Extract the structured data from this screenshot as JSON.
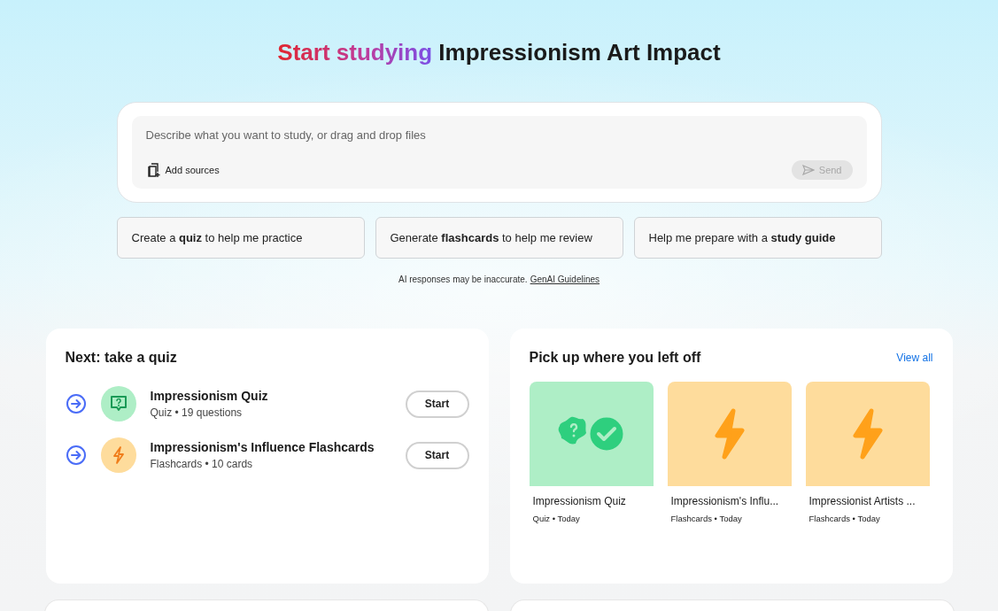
{
  "heading": {
    "highlight": "Start studying",
    "subject": "Impressionism Art Impact"
  },
  "prompt": {
    "placeholder": "Describe what you want to study, or drag and drop files",
    "add_sources": "Add sources",
    "send": {
      "label": "Send",
      "disabled": true
    }
  },
  "suggestions": [
    "Create a **quiz** to help me practice",
    "Generate **flashcards** to help me review",
    "Help me prepare with a **study guide**"
  ],
  "disclaimer": {
    "text": "AI responses may be inaccurate.",
    "link": "GenAI Guidelines"
  },
  "next": {
    "title": "Next: take a quiz",
    "items": [
      {
        "kind": "quiz",
        "title": "Impressionism Quiz",
        "meta": "Quiz • 19 questions",
        "action": "Start"
      },
      {
        "kind": "flashcards",
        "title": "Impressionism's Influence Flashcards",
        "meta": "Flashcards • 10 cards",
        "action": "Start"
      }
    ]
  },
  "recent": {
    "title": "Pick up where you left off",
    "link": "View all",
    "items": [
      {
        "kind": "quiz",
        "title": "Impressionism Quiz",
        "meta": "Quiz • Today"
      },
      {
        "kind": "flashcards",
        "title": "Impressionism's Influ...",
        "meta": "Flashcards • Today"
      },
      {
        "kind": "flashcards",
        "title": "Impressionist Artists ...",
        "meta": "Flashcards • Today"
      }
    ]
  }
}
